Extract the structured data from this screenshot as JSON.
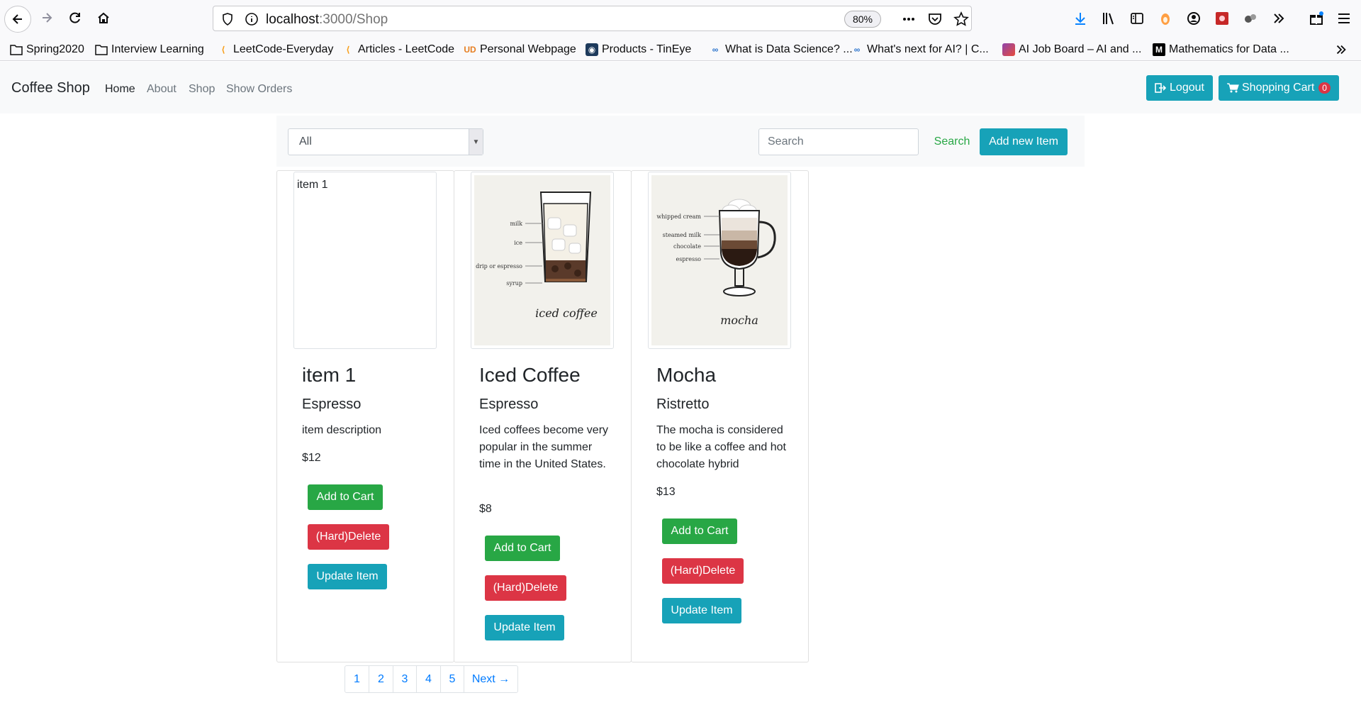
{
  "browser": {
    "url_host": "localhost",
    "url_path": ":3000/Shop",
    "zoom": "80%",
    "bookmarks": [
      {
        "label": "Spring2020",
        "icon": "folder-icon"
      },
      {
        "label": "Interview Learning",
        "icon": "folder-icon"
      },
      {
        "label": "LeetCode-Everyday",
        "icon": "leetcode-icon"
      },
      {
        "label": "Articles - LeetCode",
        "icon": "leetcode-icon"
      },
      {
        "label": "Personal Webpage",
        "icon": "personal-site-icon"
      },
      {
        "label": "Products - TinEye",
        "icon": "tineye-icon"
      },
      {
        "label": "What is Data Science? ...",
        "icon": "coursera-icon"
      },
      {
        "label": "What's next for AI? | C...",
        "icon": "coursera-icon"
      },
      {
        "label": "AI Job Board – AI and ...",
        "icon": "ai-job-board-icon"
      },
      {
        "label": "Mathematics for Data ...",
        "icon": "medium-icon"
      }
    ]
  },
  "navbar": {
    "brand": "Coffee Shop",
    "links": [
      "Home",
      "About",
      "Shop",
      "Show Orders"
    ],
    "logout_label": "Logout",
    "cart_label": "Shopping Cart",
    "cart_count": "0"
  },
  "filter": {
    "category_selected": "All",
    "search_placeholder": "Search",
    "search_label": "Search",
    "add_item_label": "Add new Item"
  },
  "products": [
    {
      "image_alt": "item 1",
      "title": "item 1",
      "subtitle": "Espresso",
      "description": "item description",
      "price": "$12",
      "add_label": "Add to Cart",
      "delete_label": "(Hard)Delete",
      "update_label": "Update Item"
    },
    {
      "image_alt": "Iced Coffee",
      "title": "Iced Coffee",
      "subtitle": "Espresso",
      "description": "Iced coffees become very popular in the summer time in the United States.",
      "price": "$8",
      "add_label": "Add to Cart",
      "delete_label": "(Hard)Delete",
      "update_label": "Update Item",
      "art_labels": [
        "milk",
        "ice",
        "drip or espresso",
        "syrup"
      ],
      "art_title": "iced coffee"
    },
    {
      "image_alt": "Mocha",
      "title": "Mocha",
      "subtitle": "Ristretto",
      "description": "The mocha is considered to be like a coffee and hot chocolate hybrid",
      "price": "$13",
      "add_label": "Add to Cart",
      "delete_label": "(Hard)Delete",
      "update_label": "Update Item",
      "art_labels": [
        "whipped cream",
        "steamed milk",
        "chocolate",
        "espresso"
      ],
      "art_title": "mocha"
    }
  ],
  "pagination": {
    "pages": [
      "1",
      "2",
      "3",
      "4",
      "5"
    ],
    "next_label": "Next →"
  }
}
